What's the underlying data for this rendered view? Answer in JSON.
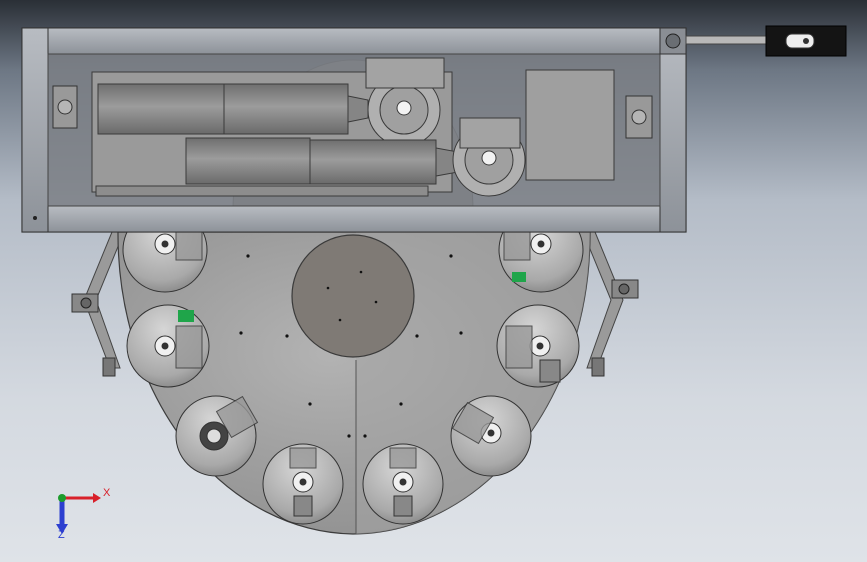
{
  "view": {
    "triad": {
      "x_label": "X",
      "z_label": "Z",
      "x_color": "#d8202a",
      "y_color": "#1c9c2c",
      "z_color": "#2c3fd0"
    },
    "colors": {
      "background_top": "#2a2f36",
      "background_bottom": "#dfe3e8",
      "metal_light": "#a6a6a6",
      "metal_dark": "#6e6e6e",
      "frame": "#9a9ea4",
      "accent_green": "#1fa54a",
      "cylinder_body": "#8a8a8a"
    },
    "icons": {
      "triad": "coordinate-triad-icon",
      "pod": "pod-socket-icon"
    }
  }
}
